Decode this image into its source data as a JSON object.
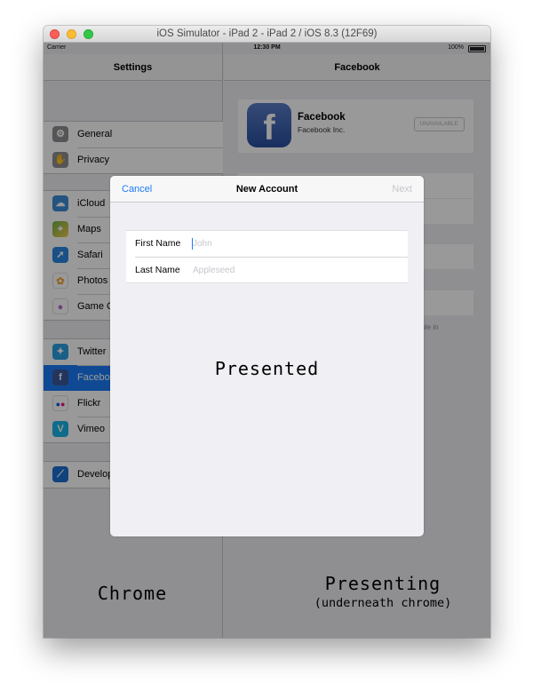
{
  "window": {
    "title": "iOS Simulator - iPad 2 - iPad 2 / iOS 8.3 (12F69)"
  },
  "status_bar": {
    "carrier": "Carrier",
    "time": "12:30 PM",
    "battery": "100%"
  },
  "master": {
    "title": "Settings",
    "groups": [
      [
        {
          "label": "General",
          "icon": "gear-icon",
          "color": "#8e8e93"
        },
        {
          "label": "Privacy",
          "icon": "hand-icon",
          "color": "#8e8e93"
        }
      ],
      [
        {
          "label": "iCloud",
          "icon": "cloud-icon",
          "color": "#3d8bd6"
        },
        {
          "label": "Maps",
          "icon": "map-icon",
          "color": "#6fb24c"
        },
        {
          "label": "Safari",
          "icon": "compass-icon",
          "color": "#2a86e2"
        },
        {
          "label": "Photos",
          "icon": "flower-icon",
          "color": "#f2a43a"
        },
        {
          "label": "Game Center",
          "icon": "bubbles-icon",
          "color": "#b06fd1"
        }
      ],
      [
        {
          "label": "Twitter",
          "icon": "bird-icon",
          "color": "#2c9fe0"
        },
        {
          "label": "Facebook",
          "icon": "facebook-icon",
          "color": "#3b5999",
          "selected": true
        },
        {
          "label": "Flickr",
          "icon": "dots-icon",
          "color": "#ffffff"
        },
        {
          "label": "Vimeo",
          "icon": "v-icon",
          "color": "#1ab3e6"
        }
      ],
      [
        {
          "label": "Developer",
          "icon": "hammer-icon",
          "color": "#1c6fd1"
        }
      ]
    ]
  },
  "detail": {
    "title": "Facebook",
    "app_name": "Facebook",
    "company": "Facebook Inc.",
    "badge": "UNAVAILABLE",
    "note": "ople in"
  },
  "modal": {
    "cancel": "Cancel",
    "title": "New Account",
    "next": "Next",
    "fields": [
      {
        "label": "First Name",
        "placeholder": "John",
        "value": ""
      },
      {
        "label": "Last Name",
        "placeholder": "Appleseed",
        "value": ""
      }
    ]
  },
  "annotations": {
    "presented": "Presented",
    "chrome": "Chrome",
    "presenting": "Presenting",
    "presenting_sub": "(underneath chrome)"
  },
  "colors": {
    "tint": "#1c7bf5",
    "dim_overlay": "rgba(0,0,0,0.40)"
  }
}
